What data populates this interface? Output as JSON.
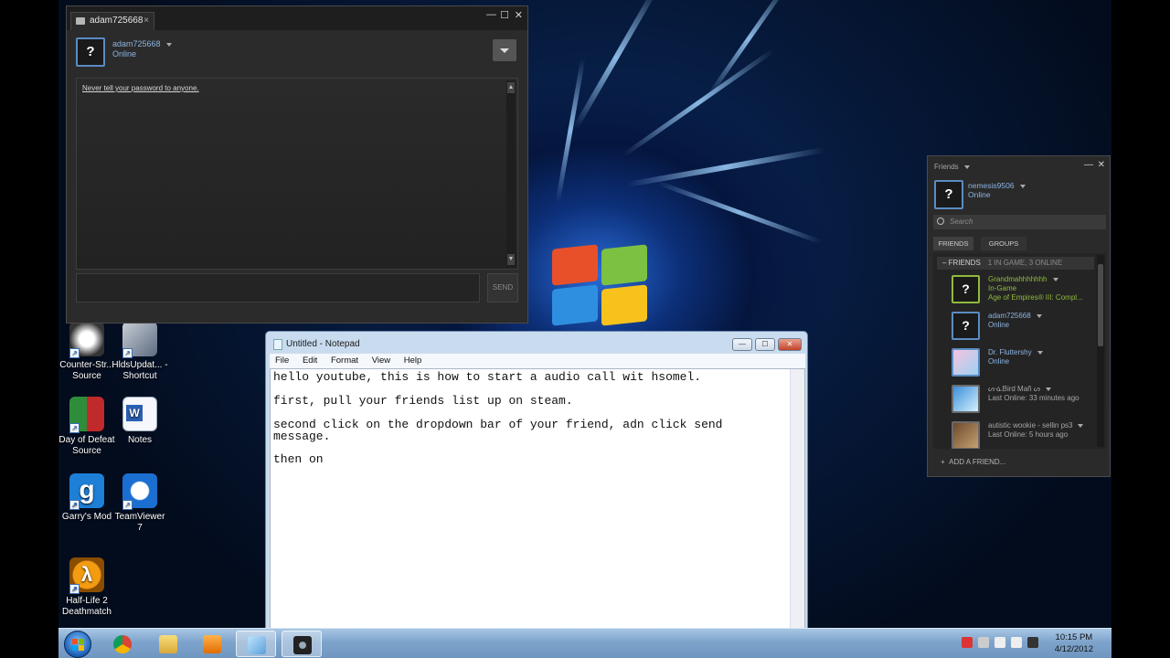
{
  "steam_chat": {
    "tab_label": "adam725668",
    "contact_name": "adam725668",
    "contact_status": "Online",
    "avatar_glyph": "?",
    "system_message": "Never tell your password to anyone.",
    "send_label": "SEND"
  },
  "notepad": {
    "title": "Untitled - Notepad",
    "menu": [
      "File",
      "Edit",
      "Format",
      "View",
      "Help"
    ],
    "lines": [
      "hello youtube, this is how to start a audio call wit hsomel.",
      "first, pull your friends list up on steam.",
      "second click on the dropdown bar of your friend, adn click send",
      "message.",
      "then on"
    ]
  },
  "friends": {
    "window_label": "Friends",
    "me": {
      "name": "nemesis9506",
      "status": "Online",
      "avatar_glyph": "?"
    },
    "search_placeholder": "Search",
    "tabs": [
      "FRIENDS",
      "GROUPS"
    ],
    "group": {
      "label": "FRIENDS",
      "counts": "1 IN GAME, 3 ONLINE"
    },
    "items": [
      {
        "name": "Grandmahhhhhhh",
        "status": "In-Game",
        "game": "Age of Empires® III: Compl...",
        "avatar": "?"
      },
      {
        "name": "adam725668",
        "status": "Online",
        "game": "",
        "avatar": "?"
      },
      {
        "name": "Dr. Fluttershy",
        "status": "Online",
        "game": "",
        "avatar": ""
      },
      {
        "name": "ᔕᓍBird Mañ ᔕ",
        "status": "Last Online: 33 minutes ago",
        "game": "",
        "avatar": ""
      },
      {
        "name": "autistic wookie - sellin ps3",
        "status": "Last Online: 5 hours ago",
        "game": "",
        "avatar": ""
      }
    ],
    "add_friend_label": "ADD A FRIEND..."
  },
  "desktop_icons": [
    {
      "label": "Counter-Str... Source"
    },
    {
      "label": "HldsUpdat... - Shortcut"
    },
    {
      "label": "Day of Defeat Source"
    },
    {
      "label": "Notes"
    },
    {
      "label": "Garry's Mod"
    },
    {
      "label": "TeamViewer 7"
    },
    {
      "label": "Half-Life 2 Deathmatch"
    }
  ],
  "taskbar": {
    "time": "10:15 PM",
    "date": "4/12/2012"
  },
  "colors": {
    "steam_online": "#8cb4e2",
    "steam_ingame": "#90ba3c",
    "steam_bg": "#2b2b2b"
  }
}
